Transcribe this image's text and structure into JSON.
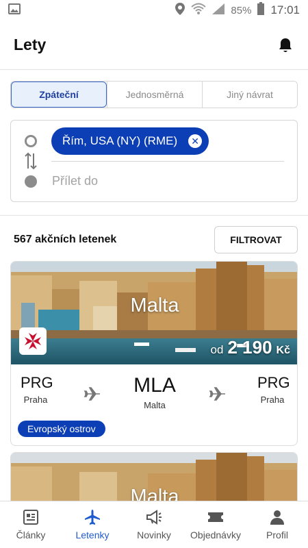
{
  "status_bar": {
    "battery": "85%",
    "time": "17:01",
    "icons": [
      "image-icon",
      "location-icon",
      "wifi-icon",
      "signal-icon",
      "battery-icon"
    ]
  },
  "header": {
    "title": "Lety",
    "icon": "bell-icon"
  },
  "tabs": [
    {
      "label": "Zpáteční",
      "active": true
    },
    {
      "label": "Jednosměrná",
      "active": false
    },
    {
      "label": "Jiný návrat",
      "active": false
    }
  ],
  "route": {
    "origin": "Řím, USA (NY) (RME)",
    "destination_placeholder": "Přílet do"
  },
  "results": {
    "count_label": "567 akčních letenek",
    "filter_label": "FILTROVAT"
  },
  "deals": [
    {
      "destination": "Malta",
      "price_prefix": "od",
      "price": "2 190",
      "currency": "Kč",
      "from_code": "PRG",
      "from_city": "Praha",
      "via_code": "MLA",
      "via_city": "Malta",
      "to_code": "PRG",
      "to_city": "Praha",
      "tag": "Evropský ostrov"
    },
    {
      "destination": "Malta"
    }
  ],
  "nav": [
    {
      "label": "Články",
      "icon": "articles-icon",
      "active": false
    },
    {
      "label": "Letenky",
      "icon": "plane-icon",
      "active": true
    },
    {
      "label": "Novinky",
      "icon": "megaphone-icon",
      "active": false
    },
    {
      "label": "Objednávky",
      "icon": "ticket-icon",
      "active": false
    },
    {
      "label": "Profil",
      "icon": "person-icon",
      "active": false
    }
  ],
  "colors": {
    "primary": "#0c3fb5",
    "active_nav": "#1f5bd0",
    "tab_active_bg": "#e8f0fb"
  }
}
